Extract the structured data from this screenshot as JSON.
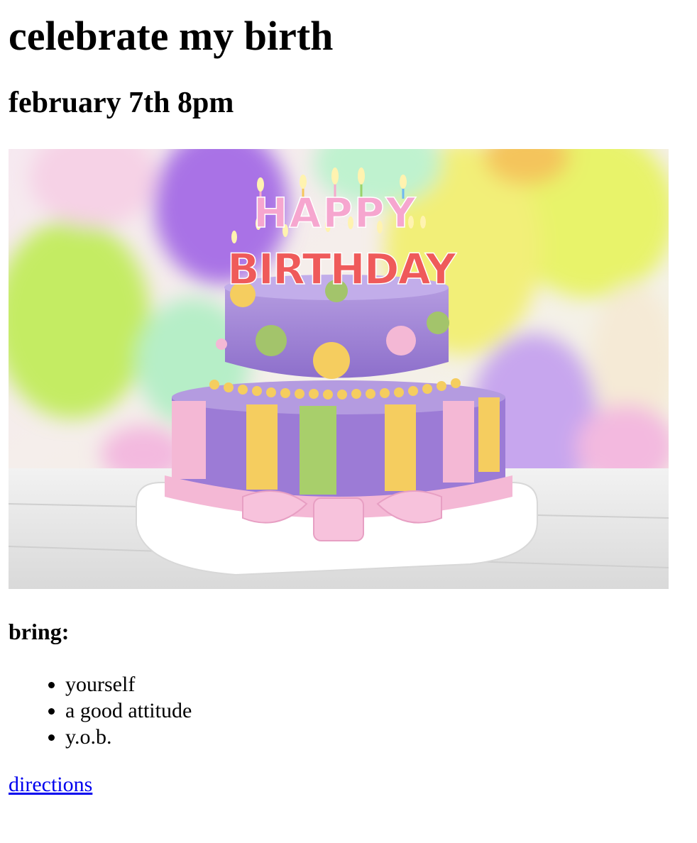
{
  "page": {
    "title": "celebrate my birth",
    "date": "february 7th 8pm",
    "bring_heading": "bring:",
    "bring_items": [
      "yourself",
      "a good attitude",
      "y.o.b."
    ],
    "directions_label": "directions"
  },
  "image": {
    "cake_text_top": "HAPPY",
    "cake_text_bottom": "BIRTHDAY"
  }
}
